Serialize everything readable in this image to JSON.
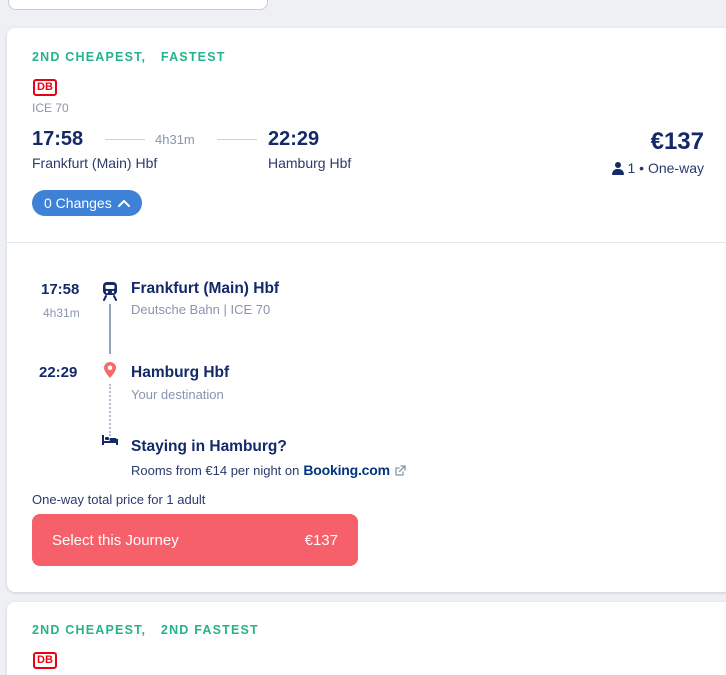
{
  "card1": {
    "tags": [
      "2ND CHEAPEST,",
      "FASTEST"
    ],
    "operator_logo": "DB",
    "train_code": "ICE 70",
    "departure_time": "17:58",
    "departure_station": "Frankfurt (Main) Hbf",
    "duration": "4h31m",
    "arrival_time": "22:29",
    "arrival_station": "Hamburg Hbf",
    "price": "€137",
    "passengers": "1 • One-way",
    "changes_label": "0 Changes"
  },
  "details": {
    "dep_time": "17:58",
    "dep_duration": "4h31m",
    "dep_station": "Frankfurt (Main) Hbf",
    "dep_operator": "Deutsche Bahn | ICE 70",
    "arr_time": "22:29",
    "arr_station": "Hamburg Hbf",
    "arr_note": "Your destination",
    "hotel_title": "Staying in Hamburg?",
    "hotel_text": "Rooms from €14 per night on",
    "hotel_partner": "Booking.com",
    "total_note": "One-way total price for 1 adult",
    "select_label": "Select this Journey",
    "select_price": "€137"
  },
  "card2": {
    "tags": [
      "2ND CHEAPEST,",
      "2ND FASTEST"
    ],
    "operator_logo": "DB"
  },
  "colors": {
    "brand_navy": "#132968",
    "tag_green": "#24b38a",
    "db_red": "#ec0016",
    "accent_blue": "#3d82d6",
    "cta_coral": "#f5606a",
    "pin_coral": "#f56a6a"
  },
  "icons": [
    "train-icon",
    "location-pin-icon",
    "bed-icon",
    "external-link-icon",
    "person-icon",
    "chevron-up-icon"
  ]
}
